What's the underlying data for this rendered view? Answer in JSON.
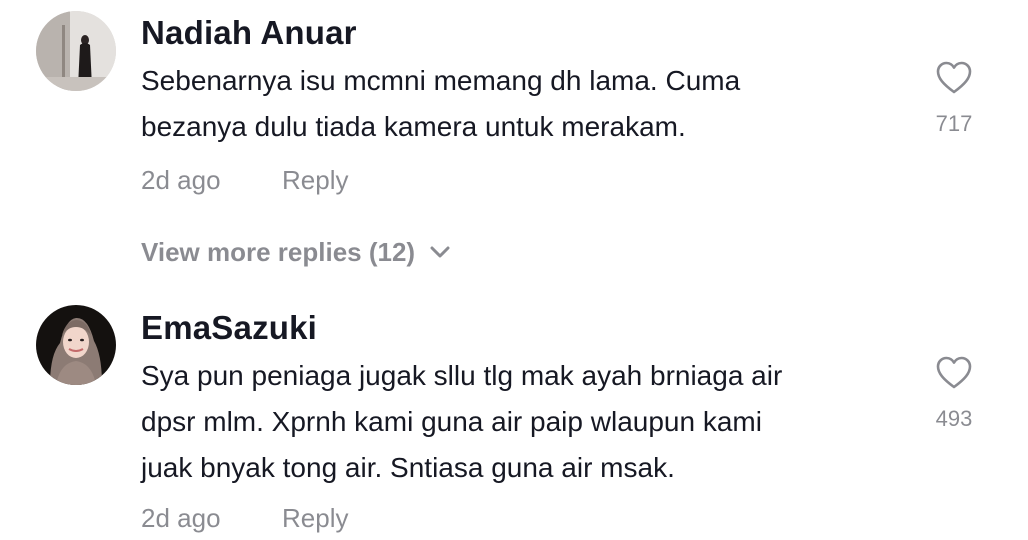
{
  "comments": [
    {
      "username": "Nadiah Anuar",
      "avatar_icon": "user-avatar-photo",
      "text_lines": [
        "Sebenarnya isu mcmni memang dh lama. Cuma",
        "bezanya dulu tiada kamera untuk merakam."
      ],
      "time": "2d ago",
      "reply_label": "Reply",
      "like_count": "717",
      "view_more_label": "View more replies (12)"
    },
    {
      "username": "EmaSazuki",
      "avatar_icon": "user-avatar-photo",
      "text_lines": [
        "Sya pun peniaga jugak sllu tlg mak ayah brniaga air",
        "dpsr mlm. Xprnh kami guna air paip wlaupun kami",
        "juak bnyak tong air. Sntiasa guna air msak."
      ],
      "time": "2d ago",
      "reply_label": "Reply",
      "like_count": "493"
    }
  ],
  "colors": {
    "primary_text": "#161823",
    "secondary_text": "#8a8b91",
    "background": "#ffffff"
  }
}
